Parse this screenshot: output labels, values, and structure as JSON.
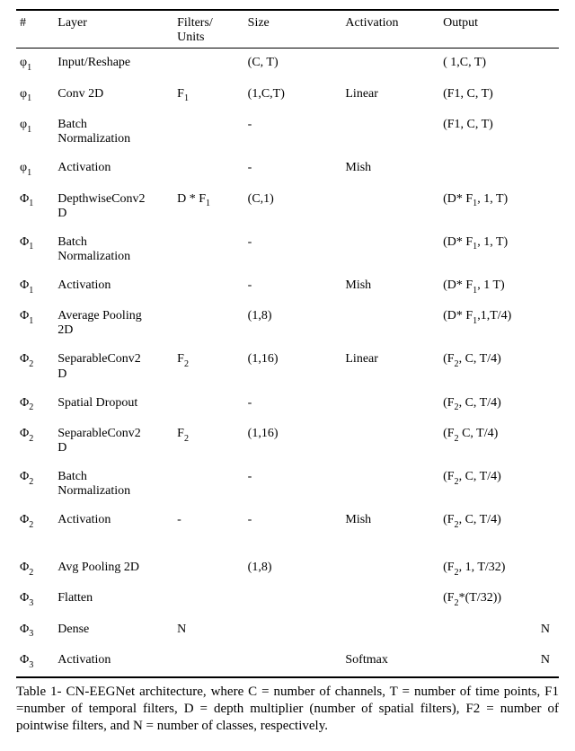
{
  "table": {
    "headers": {
      "hash": "#",
      "layer": "Layer",
      "filters_units_l1": "Filters/",
      "filters_units_l2": "Units",
      "size": "Size",
      "activation": "Activation",
      "output": "Output"
    },
    "rows": [
      {
        "hash_base": "φ",
        "hash_sub": "1",
        "layer": "Input/Reshape",
        "filters": "",
        "size": "(C, T)",
        "activation": "",
        "output": "( 1,C, T)"
      },
      {
        "hash_base": "φ",
        "hash_sub": "1",
        "layer": "Conv 2D",
        "filters_base": "F",
        "filters_sub": "1",
        "size": "(1,C,T)",
        "activation": "Linear",
        "output": "(F1, C, T)"
      },
      {
        "hash_base": "φ",
        "hash_sub": "1",
        "layer": "Batch\nNormalization",
        "filters": "",
        "size": "-",
        "activation": "",
        "output": "(F1, C, T)"
      },
      {
        "hash_base": "φ",
        "hash_sub": "1",
        "layer": "Activation",
        "filters": "",
        "size": "-",
        "activation": "Mish",
        "output": ""
      },
      {
        "hash_base": "Φ",
        "hash_sub": "1",
        "layer": "DepthwiseConv2\nD",
        "filters_pre": "D * F",
        "filters_sub": "1",
        "size": "(C,1)",
        "activation": "",
        "output_pre": "(D* F",
        "output_sub": "1",
        "output_post": ", 1, T)"
      },
      {
        "hash_base": "Φ",
        "hash_sub": "1",
        "layer": "Batch\nNormalization",
        "filters": "",
        "size": "-",
        "activation": "",
        "output_pre": "(D* F",
        "output_sub": "1",
        "output_post": ", 1, T)"
      },
      {
        "hash_base": "Φ",
        "hash_sub": "1",
        "layer": "Activation",
        "filters": "",
        "size": "-",
        "activation": "Mish",
        "output_pre": "(D* F",
        "output_sub": "1",
        "output_post": ", 1 T)"
      },
      {
        "hash_base": "Φ",
        "hash_sub": "1",
        "layer": "Average  Pooling\n2D",
        "filters": "",
        "size": "(1,8)",
        "activation": "",
        "output_pre": "(D* F",
        "output_sub": "1",
        "output_post": ",1,T/4)"
      },
      {
        "hash_base": "Φ",
        "hash_sub": "2",
        "layer": "SeparableConv2\nD",
        "filters_base": "F",
        "filters_sub": "2",
        "size": "(1,16)",
        "activation": "Linear",
        "output_pre": "(F",
        "output_sub": "2",
        "output_post": ", C, T/4)"
      },
      {
        "hash_base": "Φ",
        "hash_sub": "2",
        "layer": "Spatial Dropout",
        "filters": "",
        "size": "-",
        "activation": "",
        "output_pre": "(F",
        "output_sub": "2",
        "output_post": ", C, T/4)"
      },
      {
        "hash_base": "Φ",
        "hash_sub": "2",
        "layer": "SeparableConv2\nD",
        "filters_base": "F",
        "filters_sub": "2",
        "size": "(1,16)",
        "activation": "",
        "output_pre": "(F",
        "output_sub": "2",
        "output_post": " C, T/4)"
      },
      {
        "hash_base": "Φ",
        "hash_sub": "2",
        "layer": "Batch\nNormalization",
        "filters": "",
        "size": "-",
        "activation": "",
        "output_pre": "(F",
        "output_sub": "2",
        "output_post": ", C, T/4)"
      },
      {
        "hash_base": "Φ",
        "hash_sub": "2",
        "layer": "Activation",
        "filters": "-",
        "size": "-",
        "activation": "Mish",
        "output_pre": "(F",
        "output_sub": "2",
        "output_post": ", C, T/4)"
      },
      {
        "gap": true,
        "hash_base": "Φ",
        "hash_sub": "2",
        "layer": "Avg Pooling 2D",
        "filters": "",
        "size": "(1,8)",
        "activation": "",
        "output_pre": "(F",
        "output_sub": "2",
        "output_post": ", 1, T/32)"
      },
      {
        "hash_base": "Φ",
        "hash_sub": "3",
        "layer": "Flatten",
        "filters": "",
        "size": "",
        "activation": "",
        "output_pre": "(F",
        "output_sub": "2",
        "output_post": "*(T/32))"
      },
      {
        "hash_base": "Φ",
        "hash_sub": "3",
        "layer": "Dense",
        "filters": "N",
        "size": "",
        "activation": "",
        "output_right": "N"
      },
      {
        "hash_base": "Φ",
        "hash_sub": "3",
        "layer": "Activation",
        "filters": "",
        "size": "",
        "activation": "Softmax",
        "output_right": "N"
      }
    ]
  },
  "caption": "Table 1- CN-EEGNet architecture, where C = number of channels, T = number of time points, F1 =number of temporal filters, D = depth multiplier (number of spatial filters), F2 = number of pointwise filters, and N = number of classes, respectively."
}
